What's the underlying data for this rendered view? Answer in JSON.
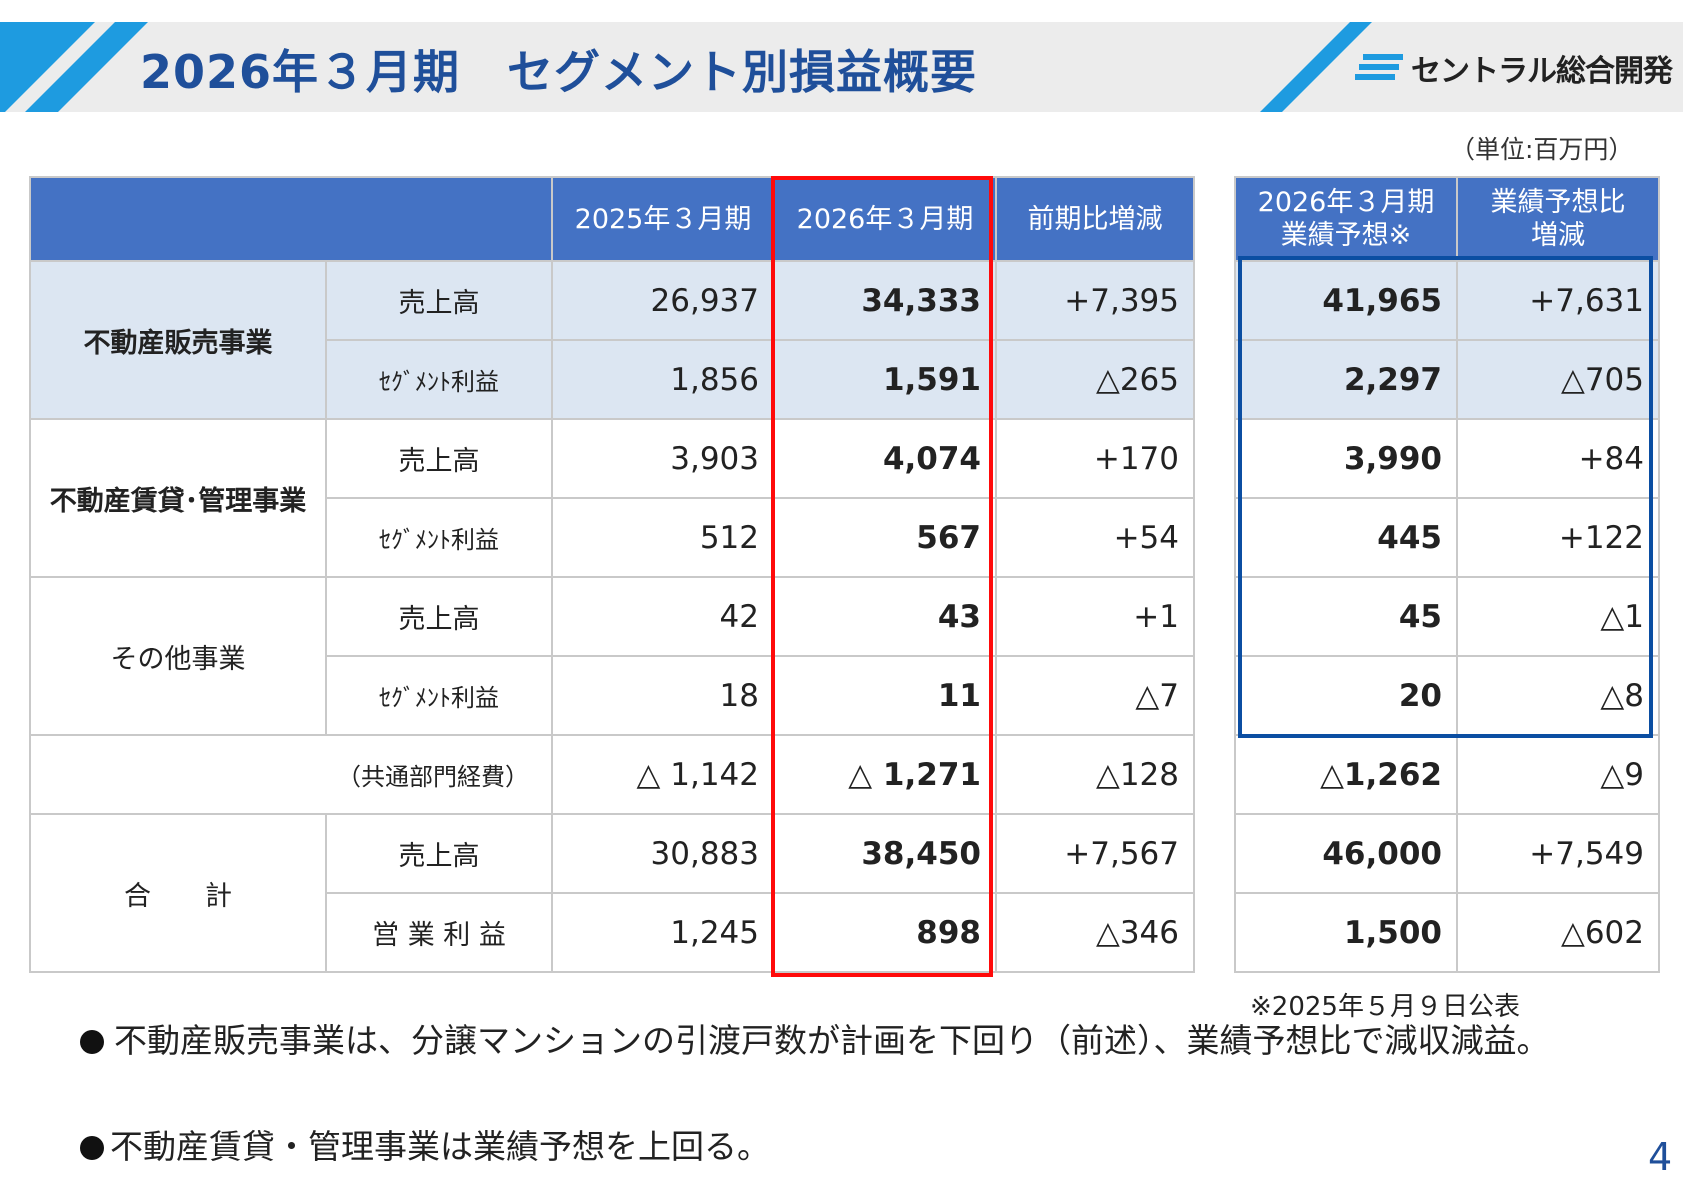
{
  "header": {
    "title": "2026年３月期　セグメント別損益概要",
    "logo_text": "セントラル総合開発"
  },
  "unit_label": "（単位:百万円）",
  "table": {
    "columns": {
      "prev": "2025年３月期",
      "curr": "2026年３月期",
      "diff": "前期比増減",
      "forecast": "2026年３月期\n業績予想※",
      "forecast_diff": "業績予想比\n増減"
    },
    "rows": [
      {
        "segment": "不動産販売事業",
        "item": "売上高",
        "prev": "26,937",
        "curr": "34,333",
        "diff": "+7,395",
        "forecast": "41,965",
        "forecast_diff": "+7,631"
      },
      {
        "segment": "",
        "item": "ｾｸﾞﾒﾝﾄ利益",
        "prev": "1,856",
        "curr": "1,591",
        "diff": "△265",
        "forecast": "2,297",
        "forecast_diff": "△705"
      },
      {
        "segment": "不動産賃貸･管理事業",
        "item": "売上高",
        "prev": "3,903",
        "curr": "4,074",
        "diff": "+170",
        "forecast": "3,990",
        "forecast_diff": "+84"
      },
      {
        "segment": "",
        "item": "ｾｸﾞﾒﾝﾄ利益",
        "prev": "512",
        "curr": "567",
        "diff": "+54",
        "forecast": "445",
        "forecast_diff": "+122"
      },
      {
        "segment": "その他事業",
        "item": "売上高",
        "prev": "42",
        "curr": "43",
        "diff": "+1",
        "forecast": "45",
        "forecast_diff": "△1"
      },
      {
        "segment": "",
        "item": "ｾｸﾞﾒﾝﾄ利益",
        "prev": "18",
        "curr": "11",
        "diff": "△7",
        "forecast": "20",
        "forecast_diff": "△8"
      },
      {
        "segment": "",
        "item": "（共通部門経費）",
        "prev": "△ 1,142",
        "curr": "△ 1,271",
        "diff": "△128",
        "forecast": "△1,262",
        "forecast_diff": "△9"
      },
      {
        "segment": "合　　計",
        "item": "売上高",
        "prev": "30,883",
        "curr": "38,450",
        "diff": "+7,567",
        "forecast": "46,000",
        "forecast_diff": "+7,549"
      },
      {
        "segment": "",
        "item": "営 業 利 益",
        "prev": "1,245",
        "curr": "898",
        "diff": "△346",
        "forecast": "1,500",
        "forecast_diff": "△602"
      }
    ]
  },
  "footnote": "※2025年５月９日公表",
  "bullets": [
    "不動産販売事業は、分譲マンションの引渡戸数が計画を下回り（前述）、業績予想比で減収減益。",
    "不動産賃貸・管理事業は業績予想を上回る。"
  ],
  "page_number": "4",
  "colors": {
    "header_blue": "#4472c4",
    "title_blue": "#1f4f9a",
    "row_highlight": "#dce6f2",
    "accent_stripe": "#1e9be0",
    "red_box": "#ff0a0a",
    "blue_box": "#0b4ea2"
  }
}
